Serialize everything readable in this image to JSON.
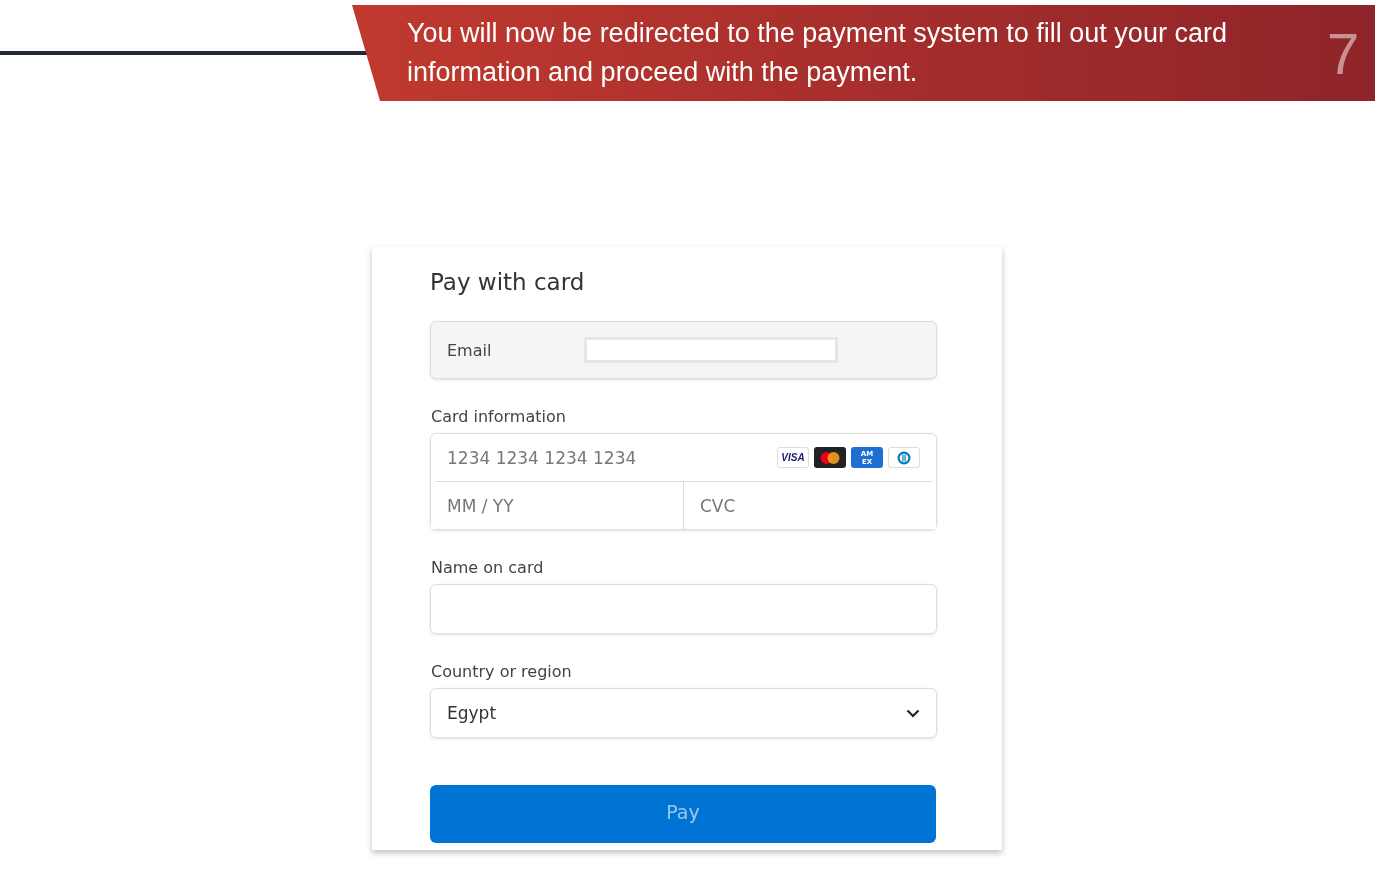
{
  "banner": {
    "text": "You will now be redirected to the payment system to fill out your card information and proceed with the payment.",
    "slide_number": "7"
  },
  "form": {
    "title": "Pay with card",
    "email": {
      "label": "Email"
    },
    "card_information": {
      "label": "Card information",
      "number_placeholder": "1234 1234 1234 1234",
      "expiry_placeholder": "MM / YY",
      "cvc_placeholder": "CVC",
      "brands": [
        {
          "kind": "visa",
          "label": "VISA"
        },
        {
          "kind": "mastercard"
        },
        {
          "kind": "amex",
          "label": "AMEX"
        },
        {
          "kind": "diners"
        }
      ]
    },
    "name_on_card": {
      "label": "Name on card"
    },
    "country": {
      "label": "Country or region",
      "value": "Egypt"
    },
    "pay_button": {
      "label": "Pay",
      "disabled": true
    }
  }
}
